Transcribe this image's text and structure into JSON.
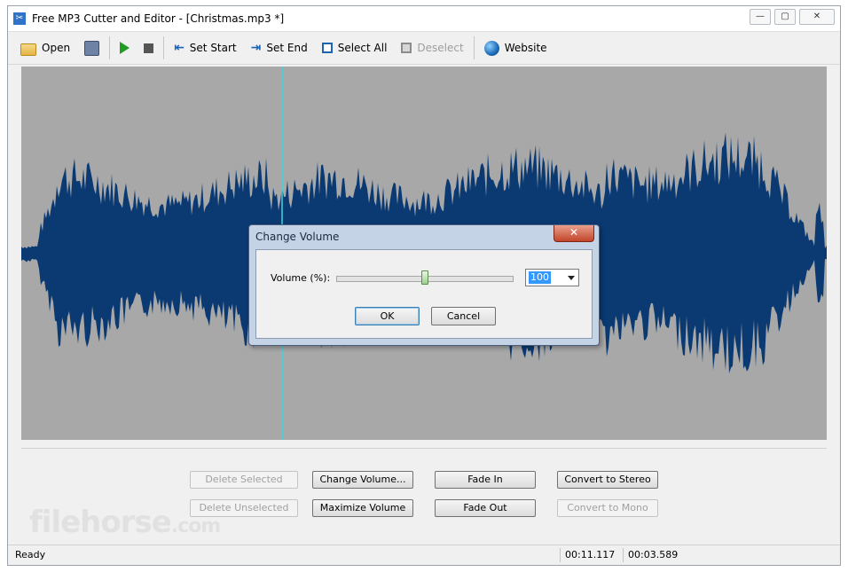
{
  "window": {
    "title": "Free MP3 Cutter and Editor - [Christmas.mp3 *]",
    "controls": {
      "minimize": "—",
      "maximize": "▢",
      "close": "✕"
    }
  },
  "toolbar": {
    "open": "Open",
    "set_start": "Set Start",
    "set_end": "Set End",
    "select_all": "Select All",
    "deselect": "Deselect",
    "website": "Website"
  },
  "waveform": {
    "background_color": "#a8a8a8",
    "wave_color": "#0b3a73",
    "cursor_color": "#3fd6df"
  },
  "actions": {
    "delete_selected": "Delete Selected",
    "delete_unselected": "Delete Unselected",
    "change_volume": "Change Volume...",
    "maximize_volume": "Maximize Volume",
    "fade_in": "Fade In",
    "fade_out": "Fade Out",
    "convert_stereo": "Convert to Stereo",
    "convert_mono": "Convert to Mono"
  },
  "watermark": {
    "name": "filehorse",
    "suffix": ".com"
  },
  "status": {
    "text": "Ready",
    "position": "00:11.117",
    "selection": "00:03.589"
  },
  "dialog": {
    "title": "Change Volume",
    "close": "✕",
    "volume_label": "Volume (%):",
    "volume_value": "100",
    "slider_fraction": 0.5,
    "ok": "OK",
    "cancel": "Cancel"
  }
}
